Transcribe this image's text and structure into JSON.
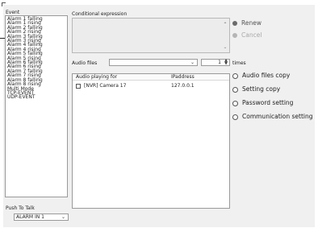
{
  "event_panel": {
    "label": "Event",
    "items": [
      "Alarm 1 falling",
      "Alarm 1 rising",
      "Alarm 2 falling",
      "Alarm 2 rising",
      "Alarm 3 falling",
      "Alarm 3 rising",
      "Alarm 4 falling",
      "Alarm 4 rising",
      "Alarm 5 falling",
      "Alarm 5 rising",
      "Alarm 6 falling",
      "Alarm 6 rising",
      "Alarm 7 falling",
      "Alarm 7 rising",
      "Alarm 8 falling",
      "Alarm 8 rising",
      "Multi Mode",
      "TCP-EVENT",
      "UDP-EVENT"
    ]
  },
  "push_to_talk": {
    "label": "Push To Talk",
    "value": "ALARM IN 1"
  },
  "conditional": {
    "label": "Conditional expression"
  },
  "audio_files": {
    "label": "Audio files",
    "value": "",
    "count": "1",
    "times_label": "times"
  },
  "table": {
    "headers": [
      "Audio playing for",
      "IPaddress"
    ],
    "rows": [
      {
        "name": "[NVR] Camera 17",
        "ip": "127.0.0.1"
      }
    ]
  },
  "actions": {
    "renew": "Renew",
    "cancel": "Cancel",
    "audio_files_copy": "Audio files copy",
    "setting_copy": "Setting copy",
    "password_setting": "Password setting",
    "communication_setting": "Communication setting"
  },
  "colors": {
    "renew_bullet": "#6b6b6b",
    "cancel_bullet": "#b5b5b5",
    "panel_bg": "#f0f0f0"
  }
}
